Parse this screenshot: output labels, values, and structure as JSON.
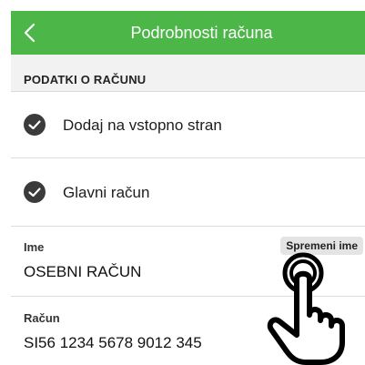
{
  "header": {
    "title": "Podrobnosti računa",
    "back_icon": "chevron-left-icon",
    "color": "#4cb648"
  },
  "section": {
    "title": "PODATKI O RAČUNU"
  },
  "options": [
    {
      "label": "Dodaj na vstopno stran",
      "icon": "check-circle-icon"
    },
    {
      "label": "Glavni račun",
      "icon": "check-circle-icon"
    }
  ],
  "name_field": {
    "label": "Ime",
    "value": "OSEBNI RAČUN",
    "action_label": "Spremeni ime"
  },
  "account_field": {
    "label": "Račun",
    "value": "SI56 1234 5678 9012 345"
  },
  "overlay": {
    "icon": "tap-hand-icon"
  }
}
